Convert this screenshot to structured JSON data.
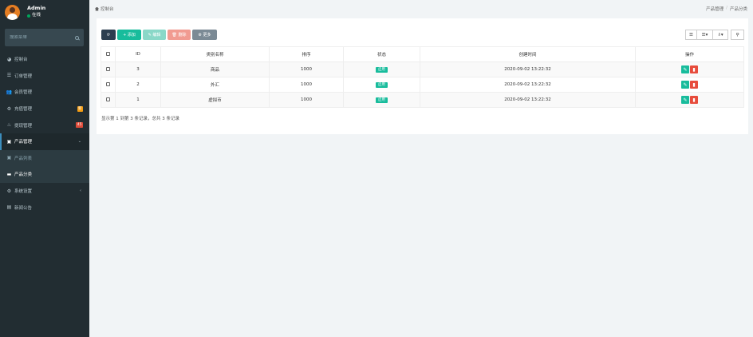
{
  "user": {
    "name": "Admin",
    "status": "在线"
  },
  "sidebar": {
    "search_placeholder": "搜索菜单",
    "items": [
      {
        "label": "控制台",
        "icon": "dashboard-icon"
      },
      {
        "label": "订单管理",
        "icon": "list-icon"
      },
      {
        "label": "会员管理",
        "icon": "users-icon"
      },
      {
        "label": "充值管理",
        "icon": "gear-icon",
        "badge": "新"
      },
      {
        "label": "提现管理",
        "icon": "flame-icon",
        "badge": "45"
      },
      {
        "label": "产品管理",
        "icon": "bag-icon",
        "chevron": "⌄"
      },
      {
        "label": "产品列表",
        "icon": "bag-icon"
      },
      {
        "label": "产品分类",
        "icon": "card-icon"
      },
      {
        "label": "系统设置",
        "icon": "cogs-icon",
        "chevron": "‹"
      },
      {
        "label": "新闻公告",
        "icon": "newspaper-icon"
      }
    ]
  },
  "topbar": {
    "title": "控制台",
    "crumbs": [
      "产品管理",
      "产品分类"
    ]
  },
  "toolbar": {
    "refresh": "⟳",
    "add": "+ 添加",
    "edit": "✎ 编辑",
    "delete": "🗑 删除",
    "more": "⚙ 更多"
  },
  "table": {
    "columns": [
      "",
      "ID",
      "类别名称",
      "排序",
      "状态",
      "创建时间",
      "操作"
    ],
    "rows": [
      {
        "id": "3",
        "name": "商品",
        "sort": "1000",
        "status": "启用",
        "created": "2020-09-02 13:22:32"
      },
      {
        "id": "2",
        "name": "外汇",
        "sort": "1000",
        "status": "启用",
        "created": "2020-09-02 13:22:32"
      },
      {
        "id": "1",
        "name": "虚拟币",
        "sort": "1000",
        "status": "启用",
        "created": "2020-09-02 13:22:32"
      }
    ]
  },
  "summary": "显示第 1 到第 3 条记录，总共 3 条记录",
  "colors": {
    "sidebar": "#222d32",
    "accent": "#18bc9c",
    "danger": "#e74c3c"
  }
}
